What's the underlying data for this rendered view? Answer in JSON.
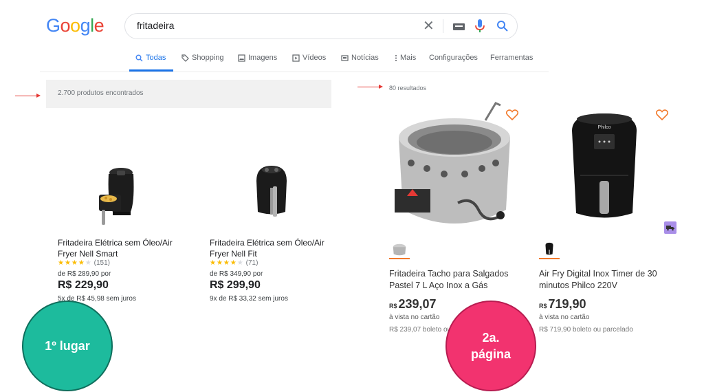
{
  "logo": {
    "letters": [
      "G",
      "o",
      "o",
      "g",
      "l",
      "e"
    ]
  },
  "search": {
    "value": "fritadeira",
    "clear_glyph": "✕"
  },
  "tabs": [
    {
      "label": "Todas",
      "icon": "search-icon",
      "active": true
    },
    {
      "label": "Shopping",
      "icon": "tag-icon"
    },
    {
      "label": "Imagens",
      "icon": "image-icon"
    },
    {
      "label": "Vídeos",
      "icon": "play-icon"
    },
    {
      "label": "Notícias",
      "icon": "news-icon"
    },
    {
      "label": "Mais",
      "icon": "more-vertical-icon"
    },
    {
      "label": "Configurações"
    },
    {
      "label": "Ferramentas"
    }
  ],
  "google_results": {
    "count_text": "2.700 produtos encontrados",
    "products": [
      {
        "title": "Fritadeira Elétrica sem Óleo/Air Fryer Nell Smart",
        "stars": 4,
        "reviews": "(151)",
        "old_price": "de R$ 289,90 por",
        "price": "R$ 229,90",
        "installments": "5x de R$ 45,98 sem juros"
      },
      {
        "title": "Fritadeira Elétrica sem Óleo/Air Fryer Nell Fit",
        "stars": 4,
        "reviews": "(71)",
        "old_price": "de R$ 349,90 por",
        "price": "R$ 299,90",
        "installments": "9x de R$ 33,32 sem juros"
      }
    ]
  },
  "marketplace": {
    "results_text": "80 resultados",
    "products": [
      {
        "title": "Fritadeira Tacho para Salgados Pastel 7 L Aço Inox a Gás",
        "currency": "R$",
        "price": "239,07",
        "cash_note": "à vista no cartão",
        "boleto": "R$ 239,07 boleto ou parcelado"
      },
      {
        "title": "Air Fry Digital Inox Timer de 30 minutos Philco 220V",
        "currency": "R$",
        "price": "719,90",
        "cash_note": "à vista no cartão",
        "boleto": "R$ 719,90 boleto ou parcelado",
        "brand_on_product": "Philco"
      }
    ]
  },
  "annotations": {
    "first_place": "1º lugar",
    "second_page": "2a. página",
    "first_place_color": "#1dbb9d",
    "second_page_color": "#f2336f",
    "arrow_color": "#e53935"
  }
}
